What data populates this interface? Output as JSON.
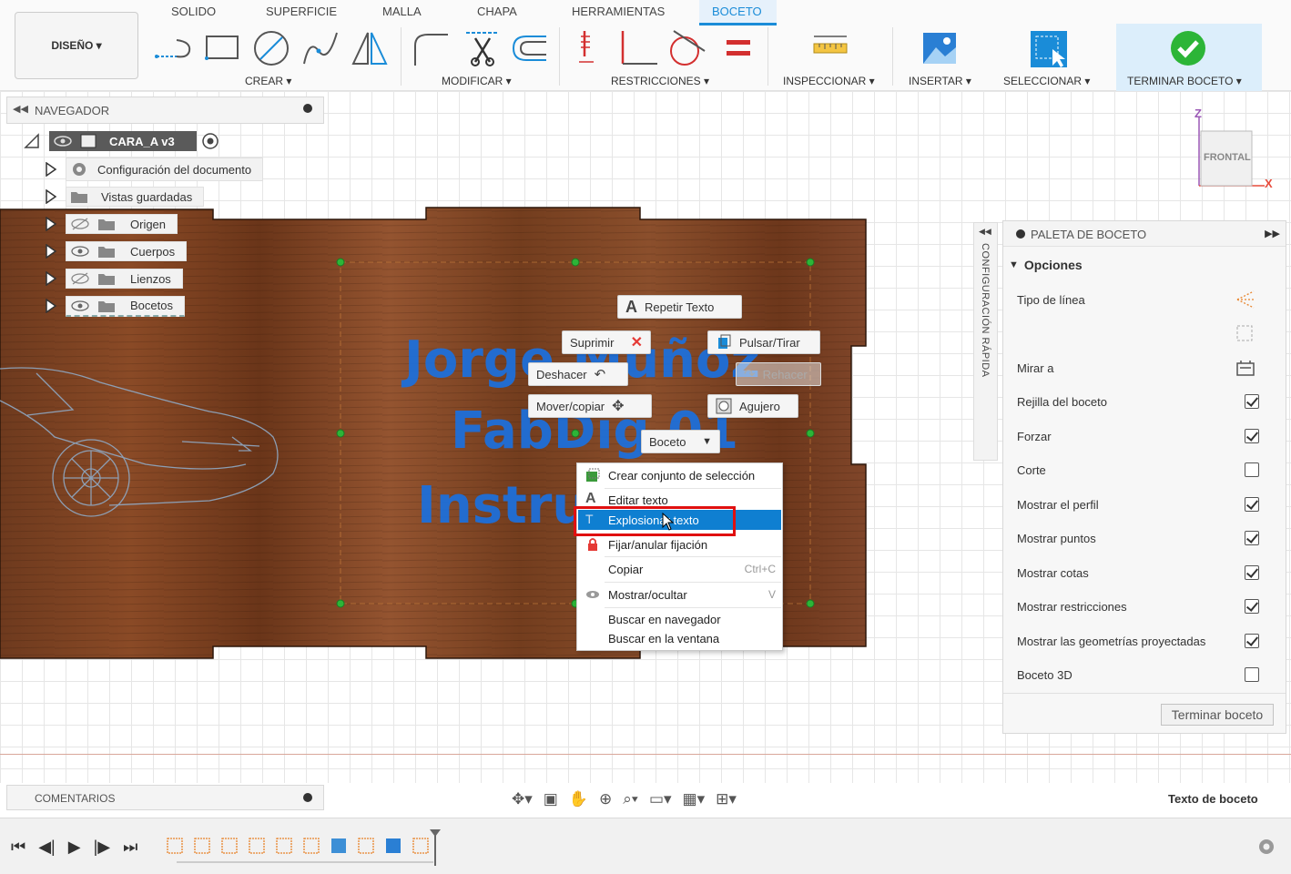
{
  "toolbar": {
    "tabs": [
      "SOLIDO",
      "SUPERFICIE",
      "MALLA",
      "CHAPA",
      "HERRAMIENTAS",
      "BOCETO"
    ],
    "active_tab": "BOCETO",
    "workspace_button": "DISEÑO ▾",
    "groups": {
      "create": "CREAR ▾",
      "modify": "MODIFICAR ▾",
      "constraints": "RESTRICCIONES ▾",
      "inspect": "INSPECCIONAR ▾",
      "insert": "INSERTAR ▾",
      "select": "SELECCIONAR ▾",
      "finish": "TERMINAR BOCETO ▾"
    }
  },
  "navigator": {
    "title": "NAVEGADOR",
    "root": "CARA_A v3",
    "items": [
      {
        "label": "Configuración del documento"
      },
      {
        "label": "Vistas guardadas"
      },
      {
        "label": "Origen"
      },
      {
        "label": "Cuerpos"
      },
      {
        "label": "Lienzos"
      },
      {
        "label": "Bocetos"
      }
    ]
  },
  "viewcube": {
    "face": "FRONTAL",
    "axis_z": "Z",
    "axis_x": "X"
  },
  "sketch_text": [
    "Jorge Muñoz",
    "FabDig 01",
    "Instru"
  ],
  "marking_menu": {
    "repeat": "Repetir Texto",
    "delete": "Suprimir",
    "press_pull": "Pulsar/Tirar",
    "undo": "Deshacer",
    "redo": "Rehacer",
    "move_copy": "Mover/copiar",
    "hole": "Agujero",
    "sketch": "Boceto"
  },
  "context_menu": {
    "items": [
      {
        "label": "Crear conjunto de selección"
      },
      {
        "label": "Editar texto"
      },
      {
        "label": "Explosionar texto"
      },
      {
        "label": "Fijar/anular fijación"
      },
      {
        "label": "Copiar",
        "shortcut": "Ctrl+C"
      },
      {
        "label": "Mostrar/ocultar",
        "shortcut": "V"
      },
      {
        "label": "Buscar en navegador"
      },
      {
        "label": "Buscar en la ventana"
      }
    ],
    "selected_index": 2
  },
  "quick_config": {
    "label": "CONFIGURACIÓN RÁPIDA"
  },
  "palette": {
    "title": "PALETA DE BOCETO",
    "section": "Opciones",
    "options": [
      {
        "label": "Tipo de línea",
        "icon": "linetype-icon"
      },
      {
        "label": "Mirar a",
        "icon": "look-at-icon"
      },
      {
        "label": "Rejilla del boceto",
        "checked": true
      },
      {
        "label": "Forzar",
        "checked": true
      },
      {
        "label": "Corte",
        "checked": false
      },
      {
        "label": "Mostrar el perfil",
        "checked": true
      },
      {
        "label": "Mostrar puntos",
        "checked": true
      },
      {
        "label": "Mostrar cotas",
        "checked": true
      },
      {
        "label": "Mostrar restricciones",
        "checked": true
      },
      {
        "label": "Mostrar las geometrías proyectadas",
        "checked": true
      },
      {
        "label": "Boceto 3D",
        "checked": false
      }
    ],
    "finish_button": "Terminar boceto"
  },
  "comments": {
    "title": "COMENTARIOS"
  },
  "status": {
    "text": "Texto de boceto"
  },
  "colors": {
    "accent": "#1a8cd8",
    "wood": "#7a3f1e",
    "sketch_text": "#1e6fd9",
    "highlight": "#e01010"
  }
}
